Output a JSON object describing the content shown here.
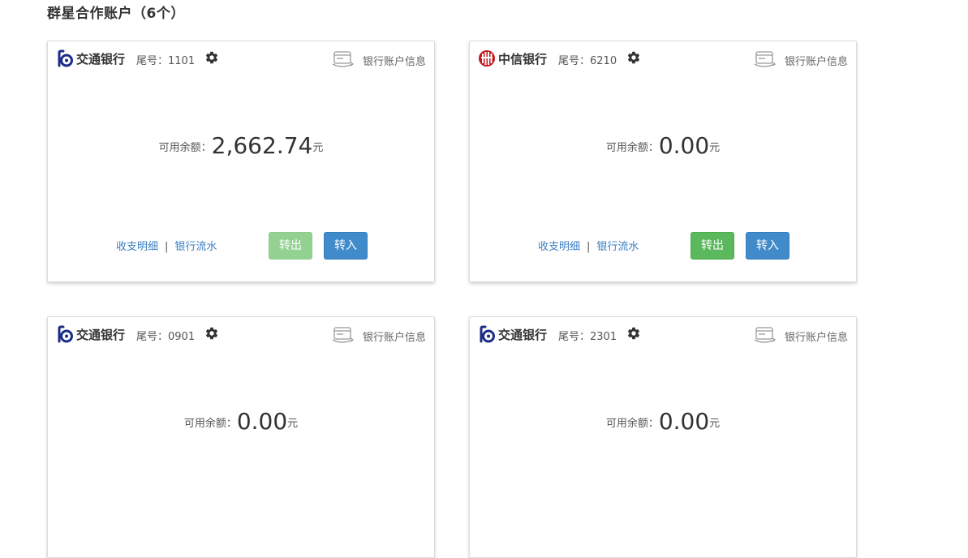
{
  "section_title": "群星合作账户（6个）",
  "cards": [
    {
      "bank_name": "交通银行",
      "bank_logo": "bocom-logo",
      "tail_label": "尾号：1101",
      "account_info_label": "银行账户信息",
      "balance_label": "可用余额：",
      "balance_amount": "2,662.74",
      "balance_unit": "元",
      "link_detail": "收支明细",
      "link_separator": "|",
      "link_flow": "银行流水",
      "btn_out": "转出",
      "btn_out_disabled": true,
      "btn_in": "转入"
    },
    {
      "bank_name": "中信银行",
      "bank_logo": "citic-logo",
      "tail_label": "尾号：6210",
      "account_info_label": "银行账户信息",
      "balance_label": "可用余额：",
      "balance_amount": "0.00",
      "balance_unit": "元",
      "link_detail": "收支明细",
      "link_separator": "|",
      "link_flow": "银行流水",
      "btn_out": "转出",
      "btn_out_disabled": false,
      "btn_in": "转入"
    },
    {
      "bank_name": "交通银行",
      "bank_logo": "bocom-logo",
      "tail_label": "尾号：0901",
      "account_info_label": "银行账户信息",
      "balance_label": "可用余额：",
      "balance_amount": "0.00",
      "balance_unit": "元"
    },
    {
      "bank_name": "交通银行",
      "bank_logo": "bocom-logo",
      "tail_label": "尾号：2301",
      "account_info_label": "银行账户信息",
      "balance_label": "可用余额：",
      "balance_amount": "0.00",
      "balance_unit": "元"
    }
  ],
  "colors": {
    "link": "#3a7fc0",
    "btn_out": "#5cb85c",
    "btn_out_disabled": "#93d193",
    "btn_in": "#428bca",
    "bocom_blue": "#1d2d87",
    "citic_red": "#c8161d"
  }
}
